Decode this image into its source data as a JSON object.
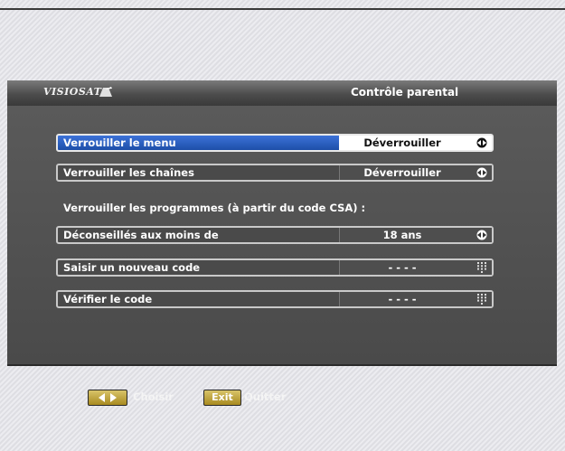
{
  "header": {
    "logo": "VISIOSAT",
    "title": "Contrôle parental"
  },
  "settings": [
    {
      "label": "Verrouiller le menu",
      "value": "Déverrouiller",
      "control": "arrows-icon",
      "selected": true
    },
    {
      "label": "Verrouiller les chaînes",
      "value": "Déverrouiller",
      "control": "arrows-icon",
      "selected": false
    }
  ],
  "section_heading": "Verrouiller les programmes (à partir du code CSA) :",
  "program_settings": [
    {
      "label": "Déconseillés aux moins de",
      "value": "18 ans",
      "control": "arrows-icon"
    },
    {
      "label": "Saisir un nouveau code",
      "value": "- - - -",
      "control": "keypad-icon"
    },
    {
      "label": "Vérifier le code",
      "value": "- - - -",
      "control": "keypad-icon"
    }
  ],
  "footer": {
    "choose_label": "Choisir",
    "exit_key": "Exit",
    "exit_label": "Quitter"
  },
  "colors": {
    "selection_blue": "#2a5fc4",
    "panel_gray": "#4a4a4a",
    "key_gold": "#c0a43a"
  }
}
